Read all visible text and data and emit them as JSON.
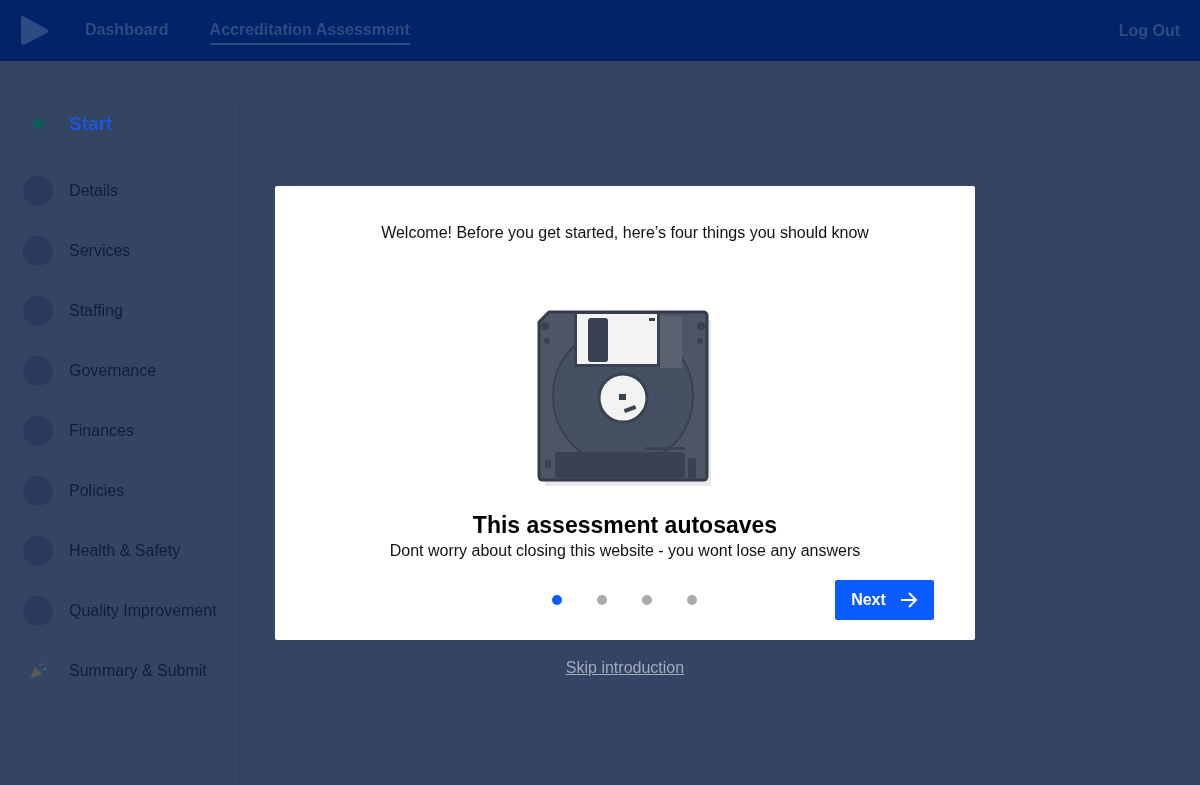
{
  "header": {
    "nav": [
      {
        "label": "Dashboard",
        "selected": false
      },
      {
        "label": "Accreditation Assessment",
        "selected": true
      }
    ],
    "logout": "Log Out"
  },
  "steps": [
    {
      "label": "Start",
      "kind": "start",
      "selected": true
    },
    {
      "label": "Details",
      "kind": "step",
      "selected": false
    },
    {
      "label": "Services",
      "kind": "step",
      "selected": false
    },
    {
      "label": "Staffing",
      "kind": "step",
      "selected": false
    },
    {
      "label": "Governance",
      "kind": "step",
      "selected": false
    },
    {
      "label": "Finances",
      "kind": "step",
      "selected": false
    },
    {
      "label": "Policies",
      "kind": "step",
      "selected": false
    },
    {
      "label": "Health & Safety",
      "kind": "step",
      "selected": false
    },
    {
      "label": "Quality Improvement",
      "kind": "step",
      "selected": false
    },
    {
      "label": "Summary & Submit",
      "kind": "final",
      "selected": false
    }
  ],
  "modal": {
    "intro": "Welcome! Before you get started, here’s four things you should know",
    "heading": "This assessment autosaves",
    "body": "Dont worry about closing this website - you wont lose any answers",
    "pages": [
      {
        "selected": true
      },
      {
        "selected": false
      },
      {
        "selected": false
      },
      {
        "selected": false
      }
    ],
    "next_button": "Next"
  },
  "skip_link": "Skip introduction"
}
